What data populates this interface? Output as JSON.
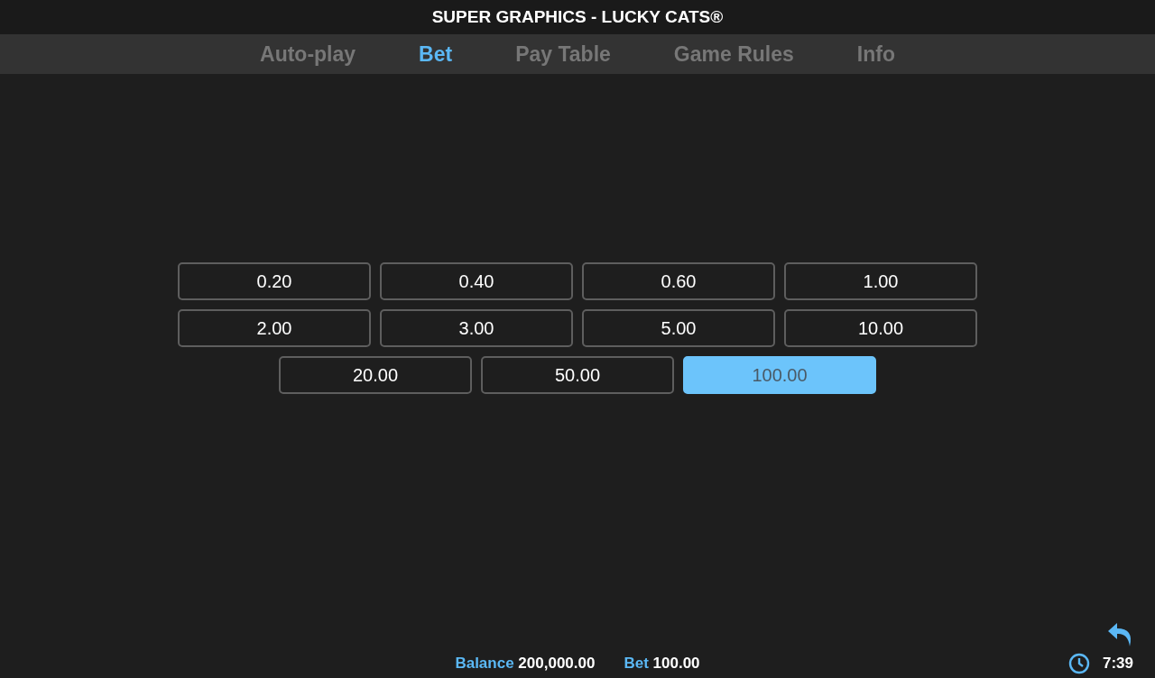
{
  "title": "SUPER GRAPHICS - LUCKY CATS®",
  "tabs": [
    {
      "label": "Auto-play",
      "selected": false
    },
    {
      "label": "Bet",
      "selected": true
    },
    {
      "label": "Pay Table",
      "selected": false
    },
    {
      "label": "Game Rules",
      "selected": false
    },
    {
      "label": "Info",
      "selected": false
    }
  ],
  "bets": [
    {
      "label": "0.20",
      "selected": false
    },
    {
      "label": "0.40",
      "selected": false
    },
    {
      "label": "0.60",
      "selected": false
    },
    {
      "label": "1.00",
      "selected": false
    },
    {
      "label": "2.00",
      "selected": false
    },
    {
      "label": "3.00",
      "selected": false
    },
    {
      "label": "5.00",
      "selected": false
    },
    {
      "label": "10.00",
      "selected": false
    },
    {
      "label": "20.00",
      "selected": false
    },
    {
      "label": "50.00",
      "selected": false
    },
    {
      "label": "100.00",
      "selected": true
    }
  ],
  "status_bar": {
    "balance_label": "Balance",
    "balance_value": "200,000.00",
    "bet_label": "Bet",
    "bet_value": "100.00",
    "time": "7:39"
  }
}
